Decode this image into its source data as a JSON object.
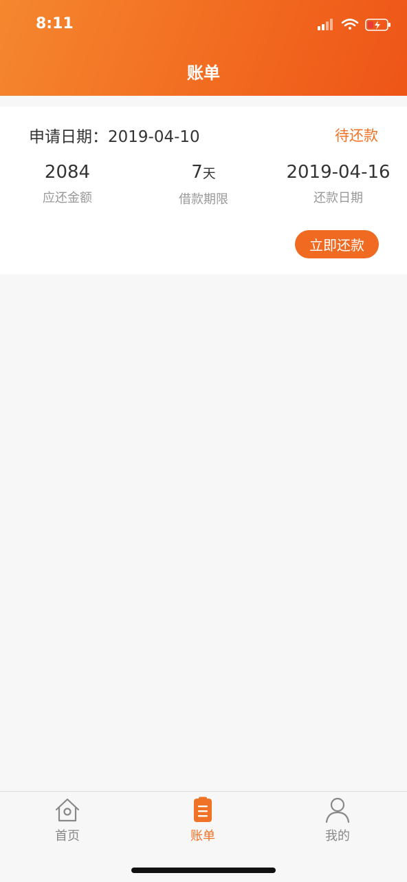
{
  "status_bar": {
    "time": "8:11"
  },
  "header": {
    "title": "账单"
  },
  "bill": {
    "apply_label": "申请日期：",
    "apply_date": "2019-04-10",
    "status": "待还款",
    "amount": "2084",
    "amount_label": "应还金额",
    "term_value": "7",
    "term_unit": "天",
    "term_label": "借款期限",
    "due_date": "2019-04-16",
    "due_label": "还款日期",
    "repay_button": "立即还款"
  },
  "tabbar": {
    "items": [
      {
        "label": "首页",
        "icon": "home-icon"
      },
      {
        "label": "账单",
        "icon": "bill-icon",
        "active": true
      },
      {
        "label": "我的",
        "icon": "profile-icon"
      }
    ],
    "accent": "#f07226",
    "inactive": "#888888"
  },
  "colors": {
    "brand_orange": "#f26b20",
    "button": "#f06a22"
  }
}
